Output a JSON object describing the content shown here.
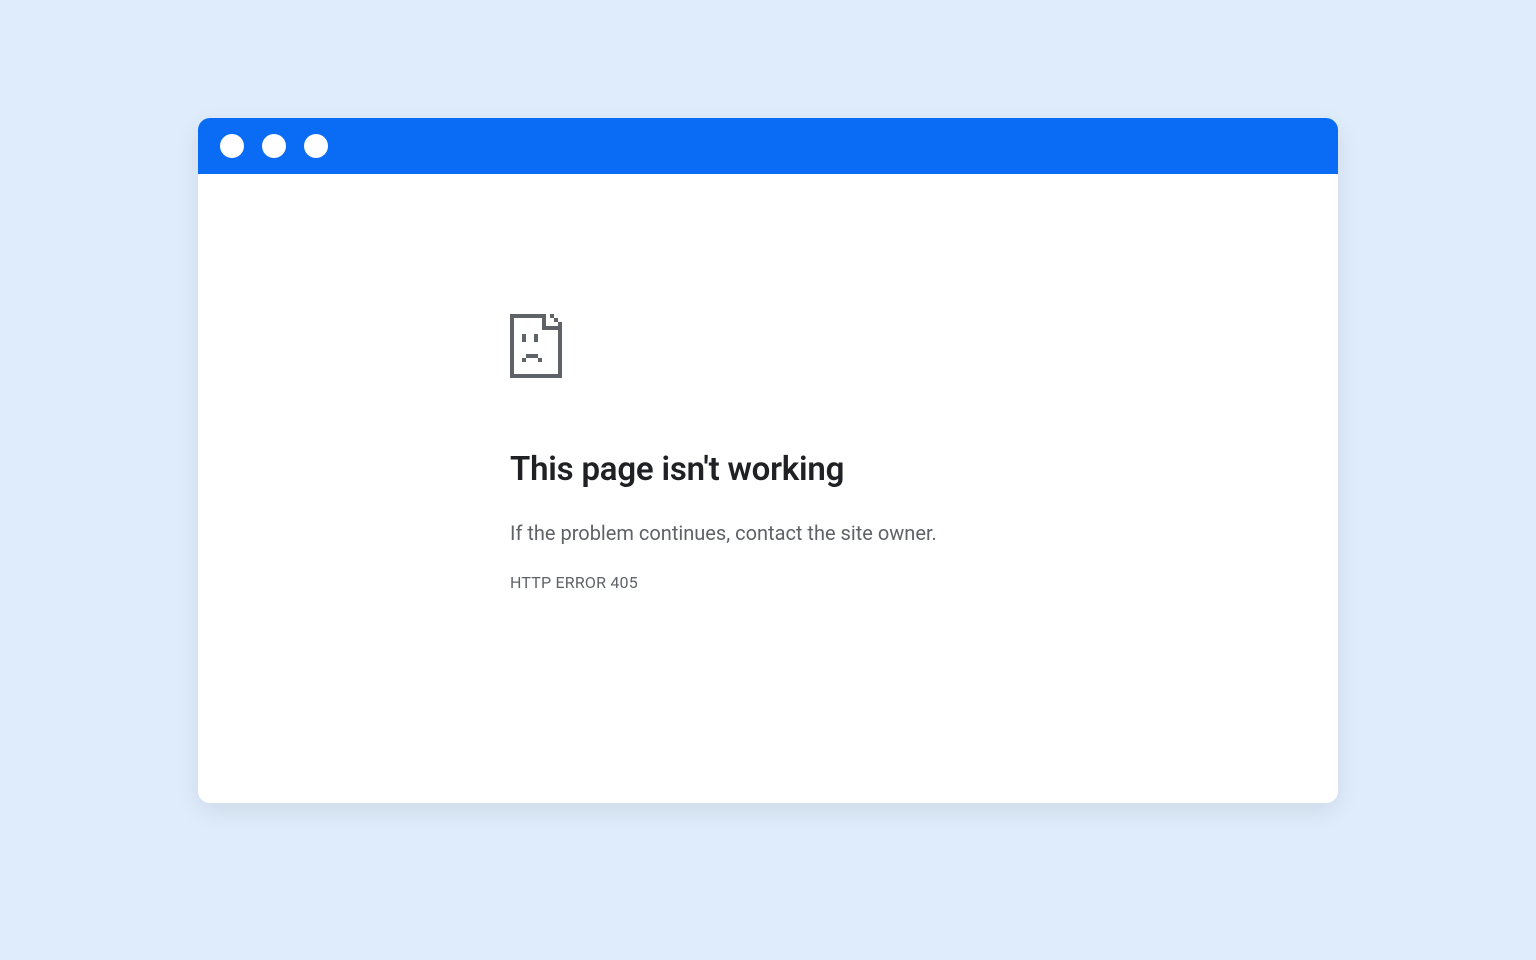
{
  "error": {
    "headline": "This page isn't working",
    "subtext": "If the problem continues, contact the site owner.",
    "code": "HTTP ERROR 405",
    "icon_name": "sad-file-icon"
  },
  "colors": {
    "page_bg": "#dfecfb",
    "titlebar_bg": "#0a6cf5",
    "window_bg": "#ffffff",
    "headline_color": "#202124",
    "body_color": "#5f6368",
    "icon_color": "#5f6368"
  }
}
